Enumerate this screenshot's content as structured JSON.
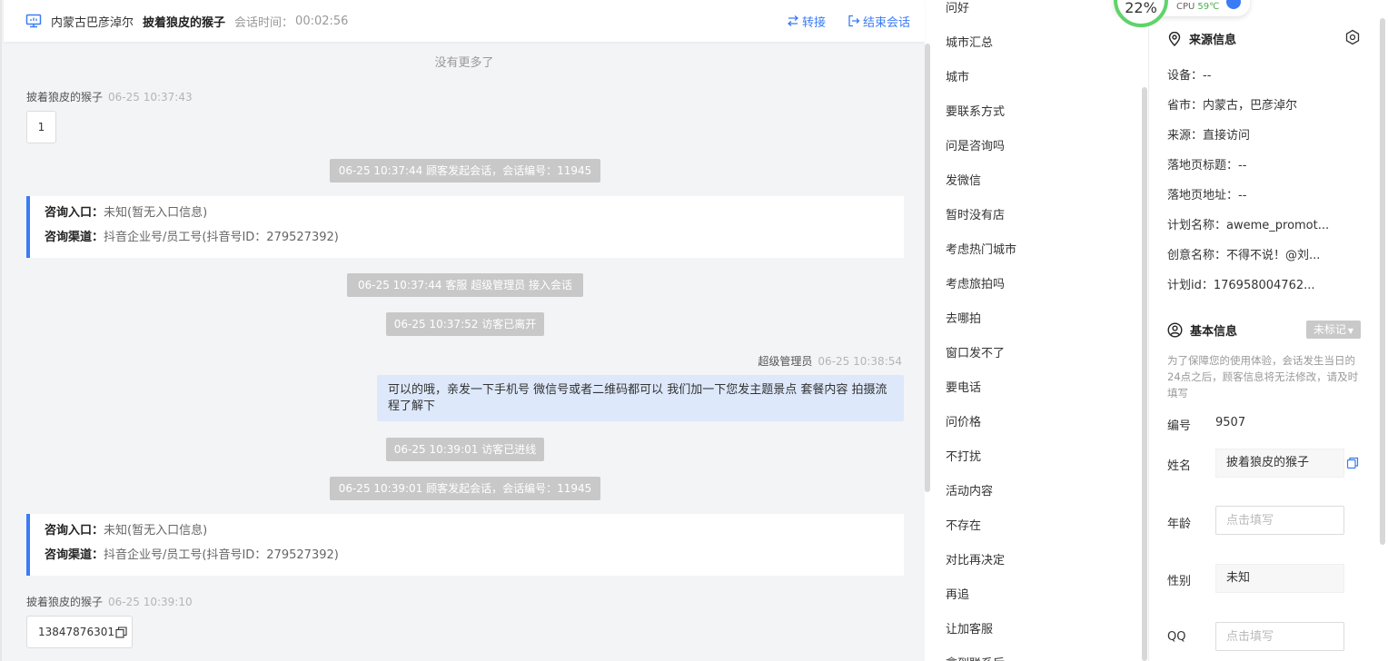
{
  "header": {
    "region": "内蒙古巴彦淖尔",
    "visitor_name": "披着狼皮的猴子",
    "time_label": "会话时间：",
    "time_value": "00:02:56",
    "transfer_label": "转接",
    "end_label": "结束会话"
  },
  "chat": {
    "no_more": "没有更多了",
    "msg1": {
      "sender": "披着狼皮的猴子",
      "time": "06-25 10:37:43",
      "text": "1"
    },
    "sys1": "06-25 10:37:44 顾客发起会话，会话编号：11945",
    "card1": {
      "entry_label": "咨询入口：",
      "entry_value": "未知(暂无入口信息)",
      "channel_label": "咨询渠道：",
      "channel_value": "抖音企业号/员工号(抖音号ID：279527392)"
    },
    "sys2": "06-25 10:37:44 客服 超级管理员 接入会话",
    "sys3": "06-25 10:37:52 访客已离开",
    "out": {
      "sender": "超级管理员",
      "time": "06-25 10:38:54",
      "text": "可以的哦，亲发一下手机号 微信号或者二维码都可以 我们加一下您发主题景点 套餐内容 拍摄流程了解下"
    },
    "sys4": "06-25 10:39:01 访客已进线",
    "sys5": "06-25 10:39:01 顾客发起会话，会话编号：11945",
    "card2": {
      "entry_label": "咨询入口：",
      "entry_value": "未知(暂无入口信息)",
      "channel_label": "咨询渠道：",
      "channel_value": "抖音企业号/员工号(抖音号ID：279527392)"
    },
    "msg2": {
      "sender": "披着狼皮的猴子",
      "time": "06-25 10:39:10",
      "text": "13847876301"
    }
  },
  "quick_replies": [
    "问好",
    "城市汇总",
    "城市",
    "要联系方式",
    "问是咨询吗",
    "发微信",
    "暂时没有店",
    "考虑热门城市",
    "考虑旅拍吗",
    "去哪拍",
    "窗口发不了",
    "要电话",
    "问价格",
    "不打扰",
    "活动内容",
    "不存在",
    "对比再决定",
    "再追",
    "让加客服",
    "拿到联系后"
  ],
  "cpu": {
    "percent": "22%",
    "label": "CPU",
    "temp": "59℃"
  },
  "source": {
    "title": "来源信息",
    "rows": [
      "设备：--",
      "省市：内蒙古，巴彦淖尔",
      "来源：直接访问",
      "落地页标题：--",
      "落地页地址：--",
      "计划名称：aweme_promot...",
      "创意名称：不得不说！@刘...",
      "计划id：176958004762..."
    ]
  },
  "basic": {
    "title": "基本信息",
    "tag_label": "未标记",
    "note": "为了保障您的使用体验，会话发生当日的24点之后，顾客信息将无法修改，请及时填写",
    "id_label": "编号",
    "id_value": "9507",
    "name_label": "姓名",
    "name_value": "披着狼皮的猴子",
    "age_label": "年龄",
    "age_placeholder": "点击填写",
    "gender_label": "性别",
    "gender_value": "未知",
    "qq_label": "QQ",
    "qq_placeholder": "点击填写"
  },
  "colors": {
    "accent": "#3a7bf6",
    "system_pill": "#c8c8c8",
    "outgoing_bubble": "#dde8fb",
    "cpu_ring": "#5fd36a"
  }
}
